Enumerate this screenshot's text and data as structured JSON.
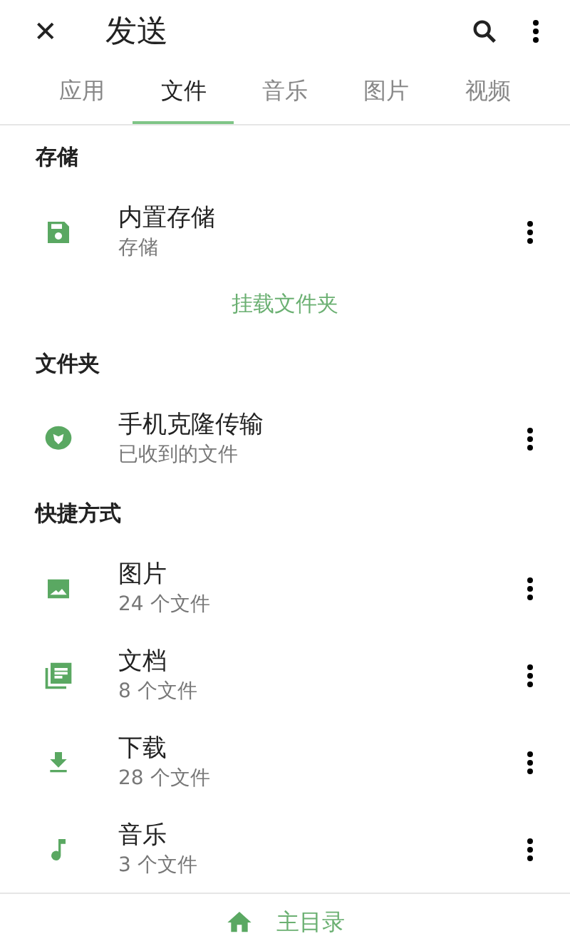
{
  "app_bar": {
    "close_glyph": "✕",
    "title": "发送"
  },
  "tabs": [
    {
      "label": "应用",
      "selected": false
    },
    {
      "label": "文件",
      "selected": true
    },
    {
      "label": "音乐",
      "selected": false
    },
    {
      "label": "图片",
      "selected": false
    },
    {
      "label": "视频",
      "selected": false
    }
  ],
  "list": [
    {
      "kind": "header",
      "title": "存储"
    },
    {
      "kind": "item",
      "title": "内置存储",
      "subtitle": "存储"
    },
    {
      "kind": "action",
      "title": "挂载文件夹"
    },
    {
      "kind": "header",
      "title": "文件夹"
    },
    {
      "kind": "item",
      "title": "手机克隆传输",
      "subtitle": "已收到的文件"
    },
    {
      "kind": "header",
      "title": "快捷方式"
    },
    {
      "kind": "item",
      "title": "图片",
      "subtitle": "24 个文件"
    },
    {
      "kind": "item",
      "title": "文档",
      "subtitle": "8 个文件"
    },
    {
      "kind": "item",
      "title": "下载",
      "subtitle": "28 个文件"
    },
    {
      "kind": "item",
      "title": "音乐",
      "subtitle": "3 个文件"
    }
  ],
  "bottom_bar": {
    "label": "主目录"
  }
}
